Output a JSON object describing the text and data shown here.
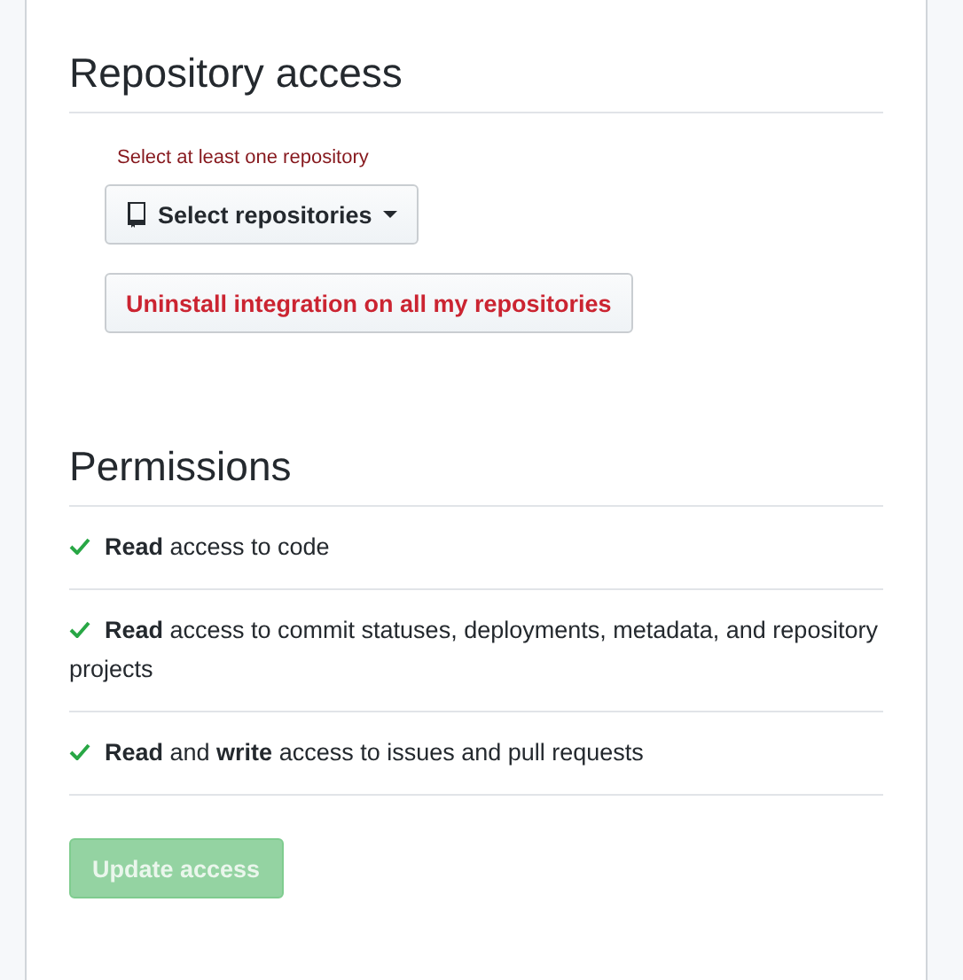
{
  "repository_access": {
    "title": "Repository access",
    "error": "Select at least one repository",
    "select_button": "Select repositories",
    "uninstall_button": "Uninstall integration on all my repositories"
  },
  "permissions": {
    "title": "Permissions",
    "items": [
      {
        "text": "**Read** access to code",
        "granted": true
      },
      {
        "text": "**Read** access to commit statuses, deployments, metadata, and repository projects",
        "granted": true
      },
      {
        "text": "**Read** and **write** access to issues and pull requests",
        "granted": true
      }
    ]
  },
  "update_button": {
    "label": "Update access",
    "disabled": true
  }
}
